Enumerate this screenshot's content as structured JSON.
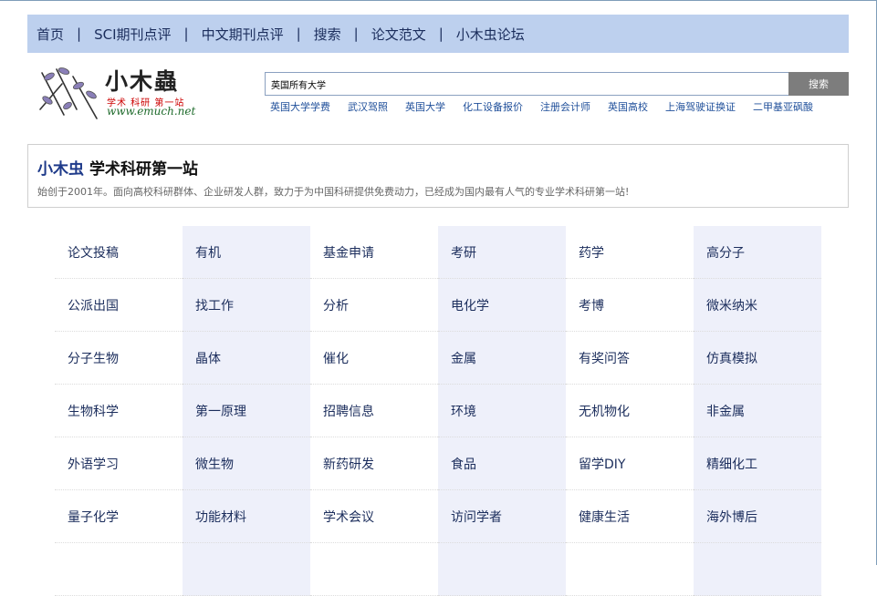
{
  "nav": {
    "items": [
      "首页",
      "SCI期刊点评",
      "中文期刊点评",
      "搜索",
      "论文范文",
      "小木虫论坛"
    ],
    "separator": "|"
  },
  "logo": {
    "title": "小木蟲",
    "subtitle": "学术 科研 第一站",
    "url": "www.emuch.net"
  },
  "search": {
    "value": "英国所有大学",
    "button_label": "搜索",
    "hot_links": [
      "英国大学学费",
      "武汉驾照",
      "英国大学",
      "化工设备报价",
      "注册会计师",
      "英国高校",
      "上海驾驶证换证",
      "二甲基亚砜酸"
    ]
  },
  "intro": {
    "brand": "小木虫",
    "headline": "学术科研第一站",
    "description": "始创于2001年。面向高校科研群体、企业研发人群，致力于为中国科研提供免费动力，已经成为国内最有人气的专业学术科研第一站!"
  },
  "categories": [
    [
      "论文投稿",
      "有机",
      "基金申请",
      "考研",
      "药学",
      "高分子"
    ],
    [
      "公派出国",
      "找工作",
      "分析",
      "电化学",
      "考博",
      "微米纳米"
    ],
    [
      "分子生物",
      "晶体",
      "催化",
      "金属",
      "有奖问答",
      "仿真模拟"
    ],
    [
      "生物科学",
      "第一原理",
      "招聘信息",
      "环境",
      "无机物化",
      "非金属"
    ],
    [
      "外语学习",
      "微生物",
      "新药研发",
      "食品",
      "留学DIY",
      "精细化工"
    ],
    [
      "量子化学",
      "功能材料",
      "学术会议",
      "访问学者",
      "健康生活",
      "海外博后"
    ],
    [
      "",
      "",
      "",
      "",
      "",
      ""
    ]
  ],
  "colors": {
    "nav_bg": "#bdd0ee",
    "column_shade": "#eef0fa",
    "link": "#1f4f9a",
    "search_button": "#7d7d7d"
  }
}
